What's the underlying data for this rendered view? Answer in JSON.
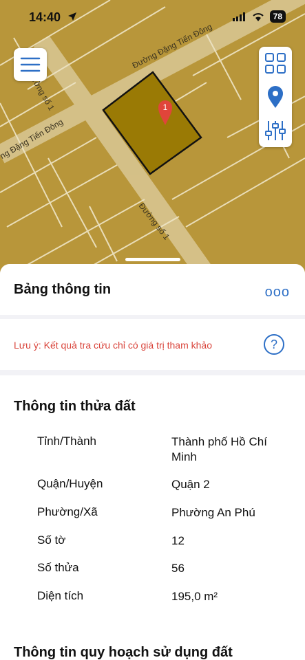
{
  "status": {
    "time": "14:40",
    "battery": "78"
  },
  "map": {
    "roads": {
      "dang_tien_dong_top": "Đường Đặng Tiến Đông",
      "dang_tien_dong_left": "ng Đặng Tiến Đông",
      "so1_top": "Đường số 1",
      "so1_bottom": "Đường số 1"
    },
    "marker_label": "1",
    "colors": {
      "map_bg": "#b8963a",
      "parcel": "#9a7a05",
      "pin": "#e0453a",
      "accent": "#2d6fc6"
    }
  },
  "sheet": {
    "title": "Bảng thông tin",
    "more_label": "ooo",
    "note": "Lưu ý: Kết quả tra cứu chỉ có giá trị tham khảo",
    "help_label": "?",
    "parcel_section_title": "Thông tin thửa đất",
    "fields": [
      {
        "label": "Tỉnh/Thành",
        "value": "Thành phố Hồ Chí Minh"
      },
      {
        "label": "Quận/Huyện",
        "value": "Quận 2"
      },
      {
        "label": "Phường/Xã",
        "value": "Phường An Phú"
      },
      {
        "label": "Số tờ",
        "value": "12"
      },
      {
        "label": "Số thửa",
        "value": "56"
      },
      {
        "label": "Diện tích",
        "value": "195,0 m²"
      }
    ],
    "planning_section_title": "Thông tin quy hoạch sử dụng đất"
  }
}
